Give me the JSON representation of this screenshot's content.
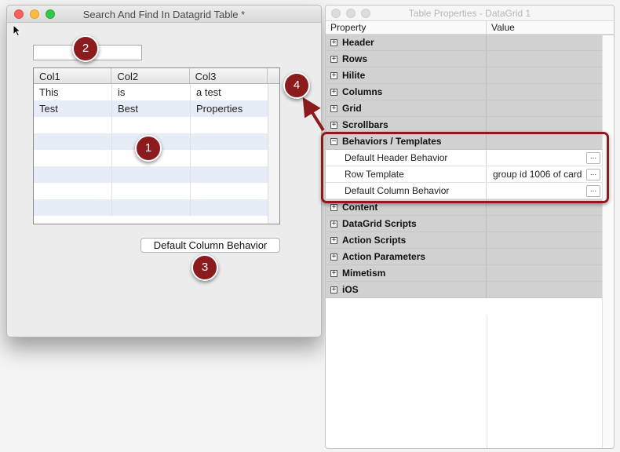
{
  "left_window": {
    "title": "Search And Find In Datagrid Table *",
    "search_value": "",
    "grid": {
      "columns": [
        "Col1",
        "Col2",
        "Col3"
      ],
      "rows": [
        [
          "This",
          "is",
          "a test"
        ],
        [
          "Test",
          "Best",
          "Properties"
        ],
        [
          "",
          "",
          ""
        ],
        [
          "",
          "",
          ""
        ],
        [
          "",
          "",
          ""
        ],
        [
          "",
          "",
          ""
        ],
        [
          "",
          "",
          ""
        ],
        [
          "",
          "",
          ""
        ]
      ]
    },
    "button_label": "Default Column Behavior"
  },
  "right_window": {
    "title": "Table Properties - DataGrid 1",
    "header": {
      "property": "Property",
      "value": "Value"
    },
    "categories_before": [
      {
        "label": "Header",
        "toggle": "+"
      },
      {
        "label": "Rows",
        "toggle": "+"
      },
      {
        "label": "Hilite",
        "toggle": "+"
      },
      {
        "label": "Columns",
        "toggle": "+"
      },
      {
        "label": "Grid",
        "toggle": "+"
      },
      {
        "label": "Scrollbars",
        "toggle": "+"
      }
    ],
    "expanded": {
      "label": "Behaviors / Templates",
      "toggle": "−",
      "items": [
        {
          "label": "Default Header Behavior",
          "value": "",
          "button": "..."
        },
        {
          "label": "Row Template",
          "value": "group id 1006 of card",
          "button": "..."
        },
        {
          "label": "Default Column Behavior",
          "value": "",
          "button": "..."
        }
      ]
    },
    "categories_after": [
      {
        "label": "Content",
        "toggle": "+"
      },
      {
        "label": "DataGrid Scripts",
        "toggle": "+"
      },
      {
        "label": "Action Scripts",
        "toggle": "+"
      },
      {
        "label": "Action Parameters",
        "toggle": "+"
      },
      {
        "label": "Mimetism",
        "toggle": "+"
      },
      {
        "label": "iOS",
        "toggle": "+"
      }
    ]
  },
  "annotations": {
    "badge_1": "1",
    "badge_2": "2",
    "badge_3": "3",
    "badge_4": "4",
    "accent_color": "#8c1b1e"
  }
}
